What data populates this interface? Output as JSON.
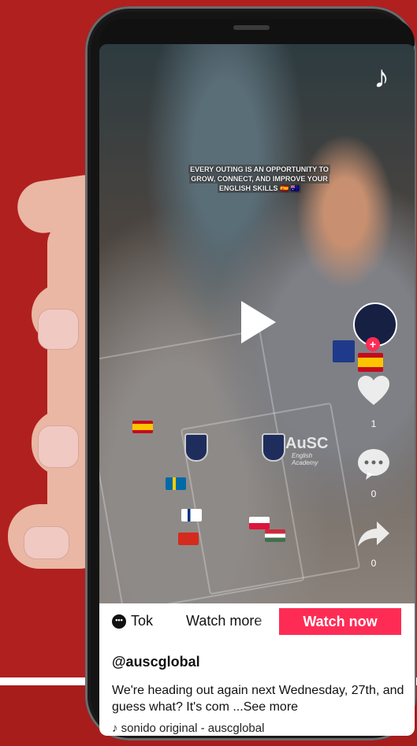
{
  "caption": {
    "line1": "EVERY OUTING IS AN OPPORTUNITY TO",
    "line2": "GROW, CONNECT, AND IMPROVE YOUR",
    "line3": "ENGLISH SKILLS 🇪🇸 🇦🇺"
  },
  "watermark": {
    "brand": "AuSC",
    "tagline": "English Academy"
  },
  "rail": {
    "likes": "1",
    "comments": "0",
    "shares": "0"
  },
  "bottom_bar": {
    "app_label": "Tok",
    "watch_more": "Watch more",
    "watch_now": "Watch now"
  },
  "post": {
    "handle": "@auscglobal",
    "description": "We're heading out again next Wednesday, 27th, and guess what? It's com ...",
    "see_more": "See more",
    "sound": "sonido original - auscglobal"
  },
  "colors": {
    "background": "#b0201f",
    "accent": "#fe2c55"
  },
  "icons": [
    "tiktok-logo-icon",
    "play-icon",
    "heart-icon",
    "comment-icon",
    "share-icon",
    "music-note-icon"
  ]
}
